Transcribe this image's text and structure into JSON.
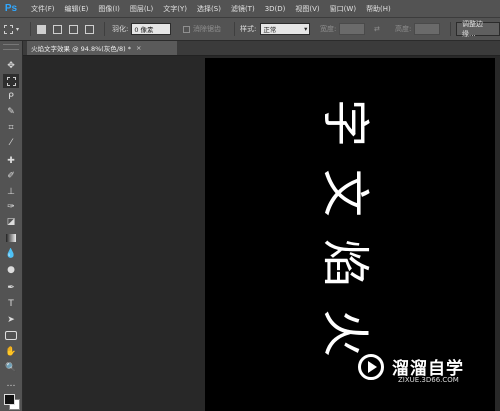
{
  "app": {
    "logo": "Ps"
  },
  "menu": [
    "文件(F)",
    "编辑(E)",
    "图像(I)",
    "图层(L)",
    "文字(Y)",
    "选择(S)",
    "滤镜(T)",
    "3D(D)",
    "视图(V)",
    "窗口(W)",
    "帮助(H)"
  ],
  "options": {
    "feather_label": "羽化:",
    "feather_value": "0 像素",
    "antialias_label": "消除锯齿",
    "style_label": "样式:",
    "style_value": "正常",
    "width_label": "宽度:",
    "height_label": "高度:",
    "refine_edge_button": "调整边缘..."
  },
  "document_tab": {
    "title": "火焰文字效果 @ 94.8%(灰色/8) *",
    "close": "×"
  },
  "canvas": {
    "background": "#000000",
    "text_chars": [
      "字",
      "文",
      "焰",
      "火"
    ],
    "text_color": "#ffffff"
  },
  "watermark": {
    "title": "溜溜自学",
    "url": "ZIXUE.3D66.COM"
  },
  "colors": {
    "foreground": "#111111",
    "background": "#ffffff",
    "ps_blue": "#31a8ff"
  }
}
